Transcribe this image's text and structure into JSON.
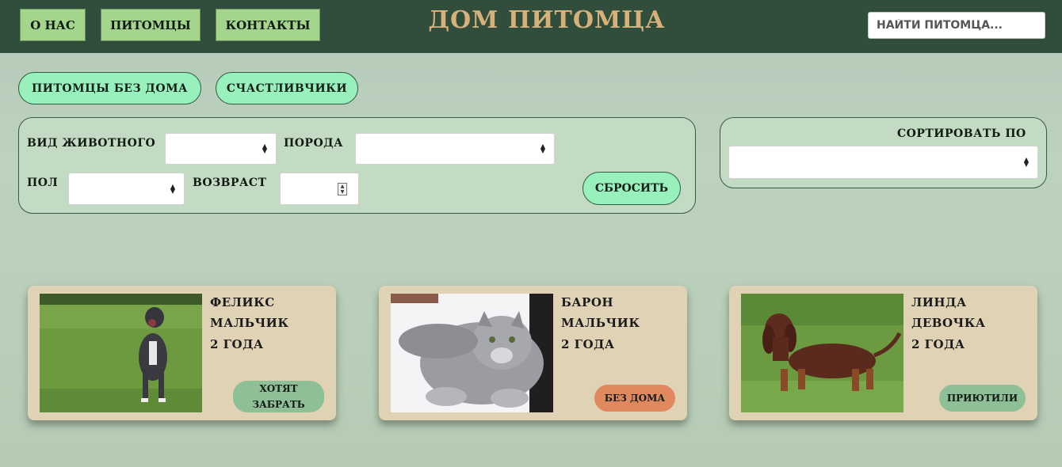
{
  "header": {
    "title": "ДОМ ПИТОМЦА",
    "nav": [
      "О НАС",
      "ПИТОМЦЫ",
      "КОНТАКТЫ"
    ],
    "search_placeholder": "НАЙТИ ПИТОМЦА..."
  },
  "tabs": [
    "ПИТОМЦЫ БЕЗ ДОМА",
    "СЧАСТЛИВЧИКИ"
  ],
  "filters": {
    "species_label": "ВИД ЖИВОТНОГО",
    "breed_label": "ПОРОДА",
    "sex_label": "ПОЛ",
    "age_label": "ВОЗВРАСТ",
    "reset_label": "СБРОСИТЬ"
  },
  "sort": {
    "label": "СОРТИРОВАТЬ ПО"
  },
  "pets": [
    {
      "name": "ФЕЛИКС",
      "sex": "МАЛЬЧИК",
      "age": "2 ГОДА",
      "status": "ХОТЯТ ЗАБРАТЬ",
      "status_color": "#8fbf96",
      "photo": "dog-photo"
    },
    {
      "name": "БАРОН",
      "sex": "МАЛЬЧИК",
      "age": "2 ГОДА",
      "status": "БЕЗ ДОМА",
      "status_color": "#e0895f",
      "photo": "cat-photo"
    },
    {
      "name": "ЛИНДА",
      "sex": "ДЕВОЧКА",
      "age": "2 ГОДА",
      "status": "ПРИЮТИЛИ",
      "status_color": "#8fbf96",
      "photo": "dachshund-photo"
    }
  ]
}
